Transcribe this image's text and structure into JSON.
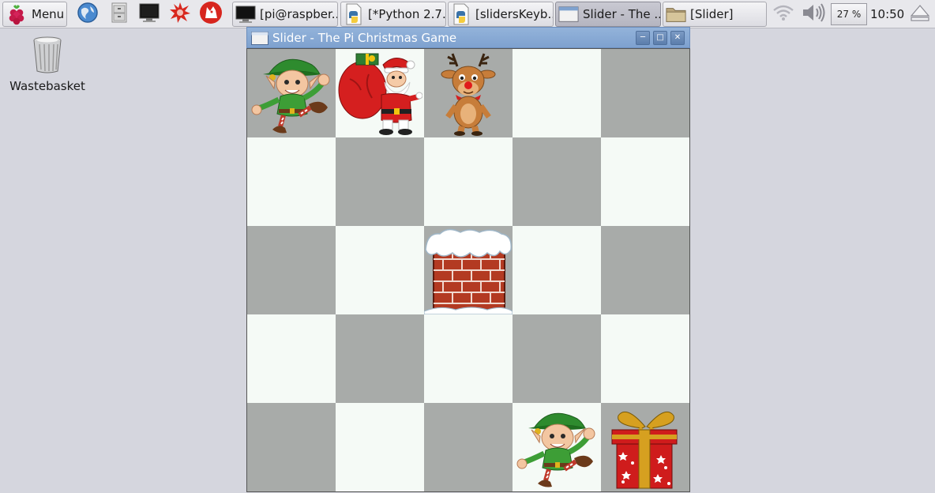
{
  "taskbar": {
    "menu_label": "Menu",
    "menu_icon": "raspberry-icon",
    "launchers": [
      "web-browser-icon",
      "file-manager-icon",
      "terminal-icon",
      "mathematica-icon",
      "wolfram-icon"
    ],
    "tasks": [
      {
        "label": "[pi@raspber...",
        "icon": "terminal-icon",
        "active": false
      },
      {
        "label": "[*Python 2.7...",
        "icon": "python-file-icon",
        "active": false
      },
      {
        "label": "[slidersKeyb...",
        "icon": "python-file-icon",
        "active": false
      },
      {
        "label": "Slider - The ...",
        "icon": "window-icon",
        "active": true
      },
      {
        "label": "[Slider]",
        "icon": "folder-icon",
        "active": false
      }
    ],
    "tray": {
      "wifi_icon": "wifi-icon",
      "volume_icon": "volume-icon",
      "battery_text": "27 %",
      "clock": "10:50",
      "eject_icon": "eject-icon"
    }
  },
  "desktop": {
    "wastebasket_label": "Wastebasket"
  },
  "window": {
    "title": "Slider - The Pi Christmas Game",
    "controls": [
      "minimize",
      "maximize",
      "close"
    ]
  },
  "board": {
    "rows": 5,
    "cols": 5,
    "colors": {
      "dark": "#a8aba9",
      "light": "#f5faf6"
    },
    "cells": [
      [
        "elf",
        "santa",
        "reindeer",
        "",
        ""
      ],
      [
        "",
        "",
        "",
        "",
        ""
      ],
      [
        "",
        "",
        "chimney",
        "",
        ""
      ],
      [
        "",
        "",
        "",
        "",
        ""
      ],
      [
        "",
        "",
        "",
        "elf",
        "present"
      ]
    ]
  }
}
